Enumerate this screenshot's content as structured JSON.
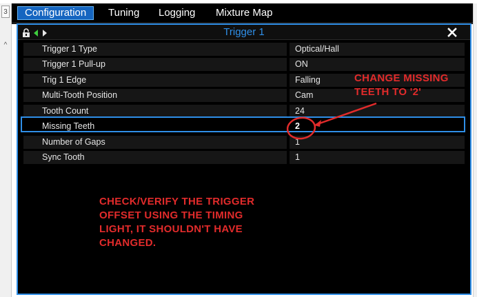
{
  "tabs": [
    {
      "label": "Configuration",
      "active": true
    },
    {
      "label": "Tuning",
      "active": false
    },
    {
      "label": "Logging",
      "active": false
    },
    {
      "label": "Mixture Map",
      "active": false
    }
  ],
  "left_gutter": {
    "tab_number": "3"
  },
  "panel": {
    "title": "Trigger 1",
    "icons": [
      "lock-icon",
      "arrow-left-icon",
      "arrow-right-icon"
    ],
    "close_icon": "close-icon"
  },
  "rows": [
    {
      "label": "Trigger 1 Type",
      "value": "Optical/Hall",
      "selected": false
    },
    {
      "label": "Trigger 1 Pull-up",
      "value": "ON",
      "selected": false
    },
    {
      "label": "Trig 1 Edge",
      "value": "Falling",
      "selected": false
    },
    {
      "label": "Multi-Tooth Position",
      "value": "Cam",
      "selected": false
    },
    {
      "label": "Tooth Count",
      "value": "24",
      "selected": false
    },
    {
      "label": "Missing Teeth",
      "value": "2",
      "selected": true
    },
    {
      "label": "Number of Gaps",
      "value": "1",
      "selected": false
    },
    {
      "label": "Sync Tooth",
      "value": "1",
      "selected": false
    }
  ],
  "annotations": {
    "missing_teeth_note": [
      "CHANGE MISSING",
      "TEETH TO '2'"
    ],
    "offset_note": [
      "CHECK/VERIFY THE TRIGGER",
      "OFFSET USING THE TIMING",
      "LIGHT, IT SHOULDN'T HAVE",
      "CHANGED."
    ]
  },
  "colors": {
    "accent": "#2f8fe8",
    "annotation": "#e22b2b",
    "background": "#000000",
    "row_bg": "#161616",
    "active_tab": "#1565c0"
  }
}
